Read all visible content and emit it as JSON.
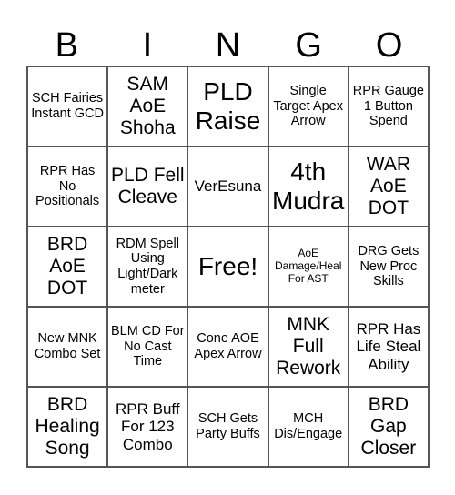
{
  "header": {
    "letters": [
      "B",
      "I",
      "N",
      "G",
      "O"
    ]
  },
  "cells": [
    {
      "text": "SCH Fairies Instant GCD",
      "size": "s-sm"
    },
    {
      "text": "SAM AoE Shoha",
      "size": "s-lg"
    },
    {
      "text": "PLD Raise",
      "size": "s-xl"
    },
    {
      "text": "Single Target Apex Arrow",
      "size": "s-sm"
    },
    {
      "text": "RPR Gauge 1 Button Spend",
      "size": "s-sm"
    },
    {
      "text": "RPR Has No Positionals",
      "size": "s-sm"
    },
    {
      "text": "PLD Fell Cleave",
      "size": "s-lg"
    },
    {
      "text": "VerEsuna",
      "size": "s-md"
    },
    {
      "text": "4th Mudra",
      "size": "s-xl"
    },
    {
      "text": "WAR AoE DOT",
      "size": "s-lg"
    },
    {
      "text": "BRD AoE DOT",
      "size": "s-lg"
    },
    {
      "text": "RDM Spell Using Light/Dark meter",
      "size": "s-sm"
    },
    {
      "text": "Free!",
      "size": "s-xl"
    },
    {
      "text": "AoE Damage/Heal For AST",
      "size": "s-xs"
    },
    {
      "text": "DRG Gets New Proc Skills",
      "size": "s-sm"
    },
    {
      "text": "New MNK Combo Set",
      "size": "s-sm"
    },
    {
      "text": "BLM CD For No Cast Time",
      "size": "s-sm"
    },
    {
      "text": "Cone AOE Apex Arrow",
      "size": "s-sm"
    },
    {
      "text": "MNK Full Rework",
      "size": "s-lg"
    },
    {
      "text": "RPR Has Life Steal Ability",
      "size": "s-md"
    },
    {
      "text": "BRD Healing Song",
      "size": "s-lg"
    },
    {
      "text": "RPR Buff For 123 Combo",
      "size": "s-md"
    },
    {
      "text": "SCH Gets Party Buffs",
      "size": "s-sm"
    },
    {
      "text": "MCH Dis/Engage",
      "size": "s-sm"
    },
    {
      "text": "BRD Gap Closer",
      "size": "s-lg"
    }
  ]
}
